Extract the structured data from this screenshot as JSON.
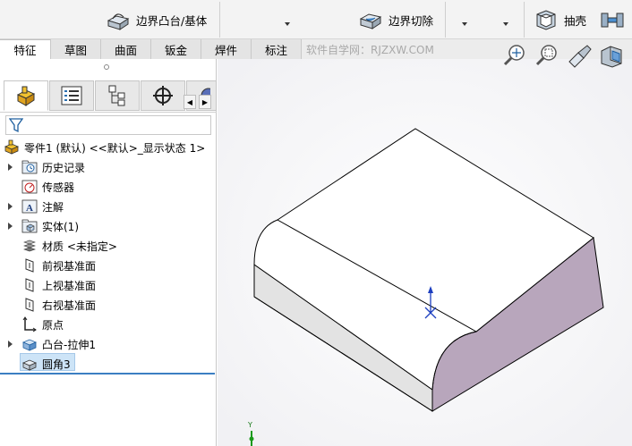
{
  "toolbar": {
    "boundary_boss_label": "边界凸台/基体",
    "boundary_cut_label": "边界切除",
    "shell_label": "抽壳"
  },
  "tabs": [
    {
      "label": "特征",
      "active": true
    },
    {
      "label": "草图",
      "active": false
    },
    {
      "label": "曲面",
      "active": false
    },
    {
      "label": "钣金",
      "active": false
    },
    {
      "label": "焊件",
      "active": false
    },
    {
      "label": "标注",
      "active": false
    }
  ],
  "watermark": "软件自学网：RJZXW.COM",
  "feature_manager": {
    "root_label": "零件1 (默认) <<默认>_显示状态 1>",
    "items": [
      {
        "label": "历史记录",
        "icon": "history-folder-icon",
        "expandable": true
      },
      {
        "label": "传感器",
        "icon": "sensor-icon",
        "expandable": false
      },
      {
        "label": "注解",
        "icon": "annotation-icon",
        "expandable": true
      },
      {
        "label": "实体(1)",
        "icon": "solid-bodies-icon",
        "expandable": true
      },
      {
        "label": "材质 <未指定>",
        "icon": "material-icon",
        "expandable": false
      },
      {
        "label": "前视基准面",
        "icon": "plane-icon",
        "expandable": false
      },
      {
        "label": "上视基准面",
        "icon": "plane-icon",
        "expandable": false
      },
      {
        "label": "右视基准面",
        "icon": "plane-icon",
        "expandable": false
      },
      {
        "label": "原点",
        "icon": "origin-icon",
        "expandable": false
      },
      {
        "label": "凸台-拉伸1",
        "icon": "extrude-icon",
        "expandable": true
      },
      {
        "label": "圆角3",
        "icon": "fillet-icon",
        "expandable": false,
        "selected": true
      }
    ]
  },
  "triad_label": "Y",
  "colors": {
    "accent": "#3b7fc2",
    "model_top": "#ffffff",
    "model_front": "#e3e3e3",
    "model_side": "#b8a6bc",
    "selection": "#cde4f7"
  }
}
